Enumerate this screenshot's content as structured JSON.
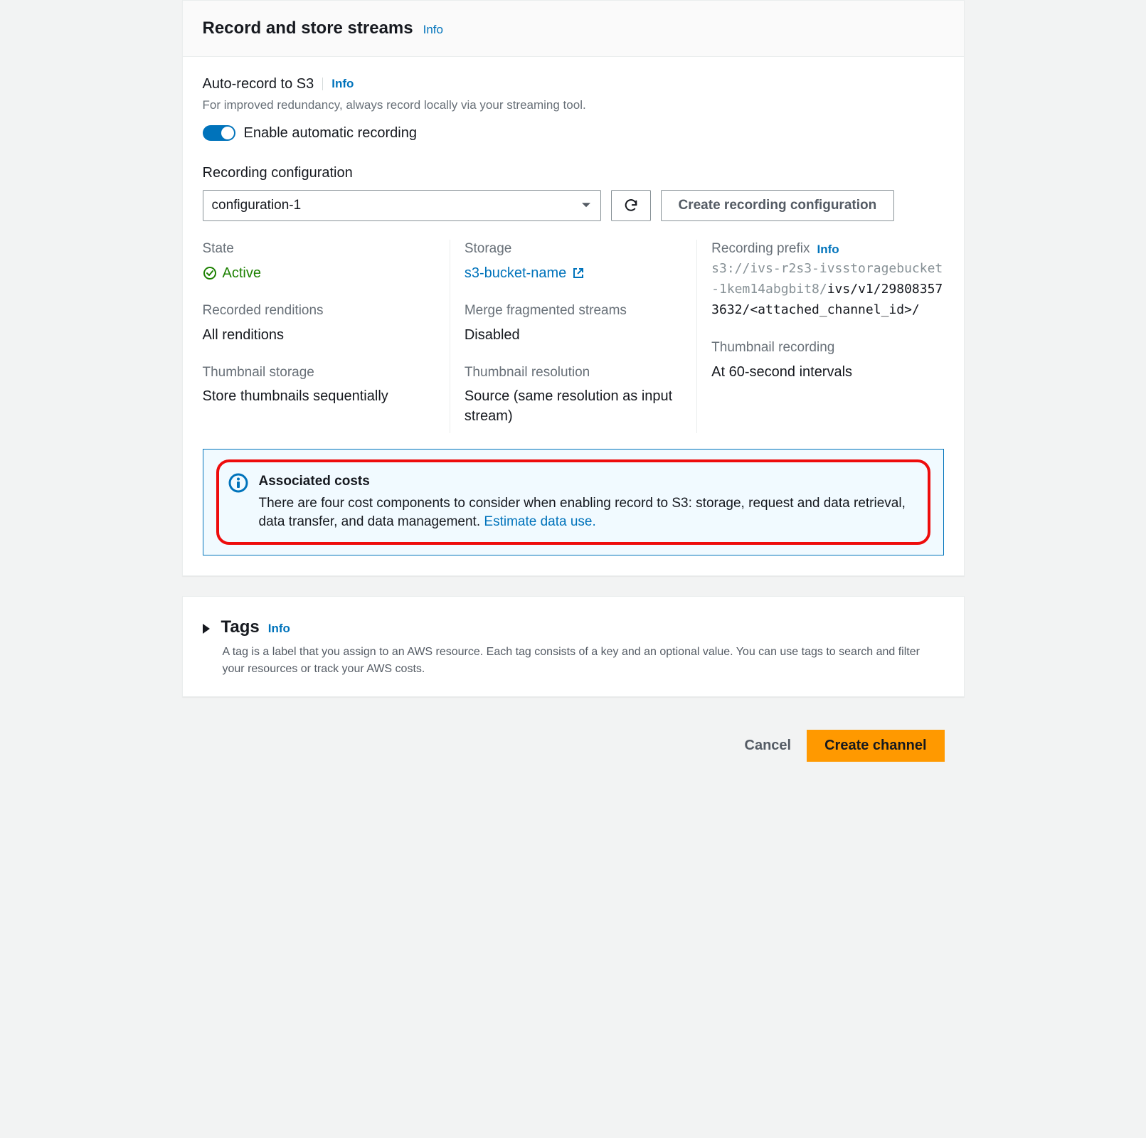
{
  "panel": {
    "title": "Record and store streams",
    "info": "Info"
  },
  "autoRecord": {
    "title": "Auto-record to S3",
    "info": "Info",
    "description": "For improved redundancy, always record locally via your streaming tool.",
    "toggleLabel": "Enable automatic recording"
  },
  "config": {
    "label": "Recording configuration",
    "selected": "configuration-1",
    "createLabel": "Create recording configuration"
  },
  "details": {
    "stateLabel": "State",
    "stateValue": "Active",
    "storageLabel": "Storage",
    "storageValue": "s3-bucket-name",
    "prefixLabel": "Recording prefix",
    "prefixInfo": "Info",
    "prefixGray": "s3://ivs-r2s3-ivsstoragebucket-1kem14abgbit8/",
    "prefixDark": "ivs/v1/298083573632/<attached_channel_id>/",
    "renditionsLabel": "Recorded renditions",
    "renditionsValue": "All renditions",
    "mergeLabel": "Merge fragmented streams",
    "mergeValue": "Disabled",
    "thumbLabel": "Thumbnail recording",
    "thumbValue": "At 60-second intervals",
    "thumbStorageLabel": "Thumbnail storage",
    "thumbStorageValue": "Store thumbnails sequentially",
    "thumbResLabel": "Thumbnail resolution",
    "thumbResValue": "Source (same resolution as input stream)"
  },
  "infoBox": {
    "title": "Associated costs",
    "text": "There are four cost components to consider when enabling record to S3: storage, request and data retrieval, data transfer, and data management. ",
    "link": "Estimate data use."
  },
  "tags": {
    "title": "Tags",
    "info": "Info",
    "description": "A tag is a label that you assign to an AWS resource. Each tag consists of a key and an optional value. You can use tags to search and filter your resources or track your AWS costs."
  },
  "footer": {
    "cancel": "Cancel",
    "create": "Create channel"
  }
}
